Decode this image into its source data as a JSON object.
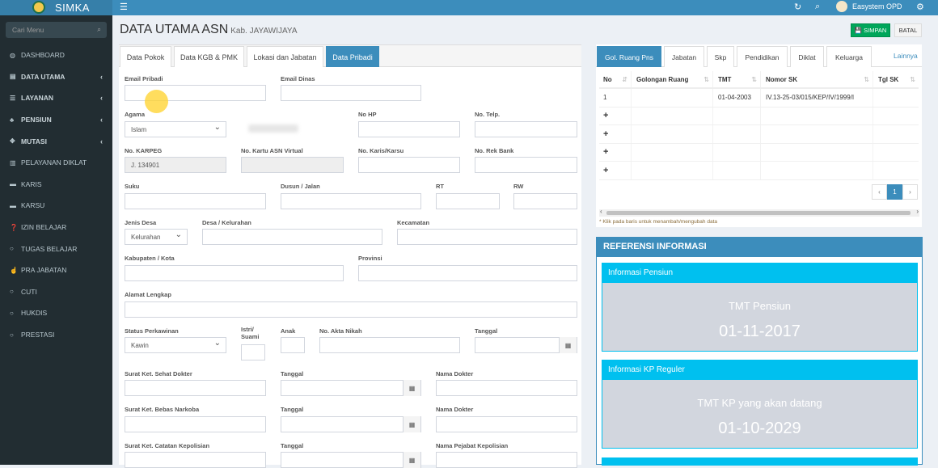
{
  "app": {
    "name": "SIMKA",
    "user": "Easystem OPD"
  },
  "sidebar": {
    "search_placeholder": "Cari Menu",
    "items": [
      {
        "label": "DASHBOARD",
        "icon": "dashboard-icon",
        "glyph": "◍",
        "bold": false,
        "chevron": false
      },
      {
        "label": "DATA UTAMA",
        "icon": "database-icon",
        "glyph": "▤",
        "bold": true,
        "chevron": true
      },
      {
        "label": "LAYANAN",
        "icon": "list-icon",
        "glyph": "☰",
        "bold": true,
        "chevron": true
      },
      {
        "label": "PENSIUN",
        "icon": "users-icon",
        "glyph": "♣",
        "bold": true,
        "chevron": true
      },
      {
        "label": "MUTASI",
        "icon": "arrows-icon",
        "glyph": "✥",
        "bold": true,
        "chevron": true
      },
      {
        "label": "PELAYANAN DIKLAT",
        "icon": "book-icon",
        "glyph": "▥",
        "bold": false,
        "chevron": false
      },
      {
        "label": "KARIS",
        "icon": "card-icon",
        "glyph": "▬",
        "bold": false,
        "chevron": false
      },
      {
        "label": "KARSU",
        "icon": "card-icon",
        "glyph": "▬",
        "bold": false,
        "chevron": false
      },
      {
        "label": "IZIN BELAJAR",
        "icon": "question-icon",
        "glyph": "❓",
        "bold": false,
        "chevron": false
      },
      {
        "label": "TUGAS BELAJAR",
        "icon": "circle-icon",
        "glyph": "○",
        "bold": false,
        "chevron": false
      },
      {
        "label": "PRA JABATAN",
        "icon": "hand-icon",
        "glyph": "☝",
        "bold": false,
        "chevron": false
      },
      {
        "label": "CUTI",
        "icon": "circle-icon",
        "glyph": "○",
        "bold": false,
        "chevron": false
      },
      {
        "label": "HUKDIS",
        "icon": "circle-icon",
        "glyph": "○",
        "bold": false,
        "chevron": false
      },
      {
        "label": "PRESTASI",
        "icon": "circle-icon",
        "glyph": "○",
        "bold": false,
        "chevron": false
      }
    ]
  },
  "header": {
    "title": "DATA UTAMA ASN",
    "subtitle": "Kab. JAYAWIJAYA",
    "save_label": "SIMPAN",
    "cancel_label": "BATAL"
  },
  "tabs": [
    "Data Pokok",
    "Data KGB & PMK",
    "Lokasi dan Jabatan",
    "Data Pribadi"
  ],
  "form": {
    "email_pribadi": "Email Pribadi",
    "email_dinas": "Email Dinas",
    "agama": "Agama",
    "agama_val": "Islam",
    "no_hp": "No HP",
    "no_telp": "No. Telp.",
    "no_karpeg": "No. KARPEG",
    "no_karpeg_val": "J. 134901",
    "no_kartu": "No. Kartu ASN Virtual",
    "no_karis": "No. Karis/Karsu",
    "no_rek": "No. Rek Bank",
    "suku": "Suku",
    "dusun": "Dusun / Jalan",
    "rt": "RT",
    "rw": "RW",
    "jenis_desa": "Jenis Desa",
    "jenis_desa_val": "Kelurahan",
    "desa": "Desa / Kelurahan",
    "kecamatan": "Kecamatan",
    "kabupaten": "Kabupaten / Kota",
    "provinsi": "Provinsi",
    "alamat": "Alamat Lengkap",
    "status": "Status Perkawinan",
    "status_val": "Kawin",
    "istri": "Istri/ Suami",
    "anak": "Anak",
    "akta": "No. Akta Nikah",
    "tanggal": "Tanggal",
    "sehat": "Surat Ket. Sehat Dokter",
    "nama_dokter": "Nama Dokter",
    "narkoba": "Surat Ket. Bebas Narkoba",
    "polisi": "Surat Ket. Catatan Kepolisian",
    "pejabat": "Nama Pejabat Kepolisian"
  },
  "right": {
    "tabs": [
      "Gol. Ruang Pns",
      "Jabatan",
      "Skp",
      "Pendidikan",
      "Diklat",
      "Keluarga"
    ],
    "more": "Lainnya",
    "columns": [
      "No",
      "Golongan Ruang",
      "TMT",
      "Nomor SK",
      "Tgl SK"
    ],
    "row1": {
      "no": "1",
      "gol": "",
      "tmt": "01-04-2003",
      "sk": "IV.13-25-03/015/KEP/IV/1999/I",
      "tgl": ""
    },
    "plus": "+",
    "page": "1",
    "prev": "‹",
    "next": "›",
    "note": "* Klik pada baris untuk menambah/mengubah data"
  },
  "ref": {
    "title": "REFERENSI INFORMASI",
    "card1": {
      "title": "Informasi Pensiun",
      "label": "TMT Pensiun",
      "value": "01-11-2017"
    },
    "card2": {
      "title": "Informasi KP Reguler",
      "label": "TMT KP yang akan datang",
      "value": "01-10-2029"
    }
  }
}
